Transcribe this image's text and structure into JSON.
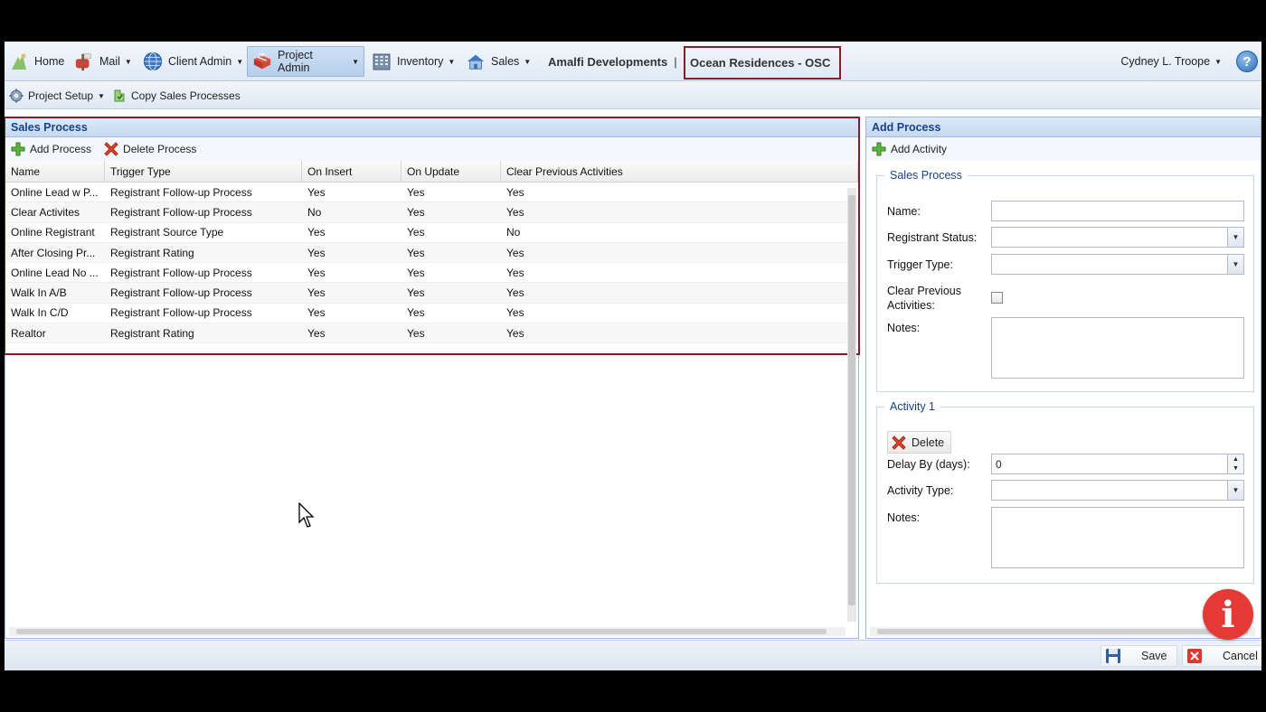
{
  "menubar": {
    "home": "Home",
    "mail": "Mail",
    "client_admin": "Client Admin",
    "project_admin": "Project Admin",
    "inventory": "Inventory",
    "sales": "Sales",
    "company": "Amalfi Developments",
    "project": "Ocean Residences - OSC",
    "user": "Cydney L. Troope",
    "help": "?"
  },
  "subbar": {
    "project_setup": "Project Setup",
    "copy_sales_processes": "Copy Sales Processes"
  },
  "sales_process_panel": {
    "title": "Sales Process",
    "add_process": "Add Process",
    "delete_process": "Delete Process",
    "columns": [
      "Name",
      "Trigger Type",
      "On Insert",
      "On Update",
      "Clear Previous Activities"
    ],
    "rows": [
      [
        "Online Lead w P...",
        "Registrant Follow-up Process",
        "Yes",
        "Yes",
        "Yes"
      ],
      [
        "Clear Activites",
        "Registrant Follow-up Process",
        "No",
        "Yes",
        "Yes"
      ],
      [
        "Online Registrant",
        "Registrant Source Type",
        "Yes",
        "Yes",
        "No"
      ],
      [
        "After Closing Pr...",
        "Registrant Rating",
        "Yes",
        "Yes",
        "Yes"
      ],
      [
        "Online Lead No ...",
        "Registrant Follow-up Process",
        "Yes",
        "Yes",
        "Yes"
      ],
      [
        "Walk In A/B",
        "Registrant Follow-up Process",
        "Yes",
        "Yes",
        "Yes"
      ],
      [
        "Walk In C/D",
        "Registrant Follow-up Process",
        "Yes",
        "Yes",
        "Yes"
      ],
      [
        "Realtor",
        "Registrant Rating",
        "Yes",
        "Yes",
        "Yes"
      ]
    ]
  },
  "add_process_panel": {
    "title": "Add Process",
    "add_activity": "Add Activity",
    "sales_process_legend": "Sales Process",
    "name_label": "Name:",
    "name_value": "",
    "registrant_status_label": "Registrant Status:",
    "registrant_status_value": "",
    "trigger_type_label": "Trigger Type:",
    "trigger_type_value": "",
    "clear_previous_label_1": "Clear Previous",
    "clear_previous_label_2": "Activities:",
    "notes_label": "Notes:",
    "activity_legend": "Activity 1",
    "delete": "Delete",
    "delay_label": "Delay By (days):",
    "delay_value": "0",
    "activity_type_label": "Activity Type:",
    "activity_type_value": "",
    "activity_notes_label": "Notes:"
  },
  "bottombar": {
    "save": "Save",
    "cancel": "Cancel"
  },
  "info_button": "i",
  "colors": {
    "highlight_border": "#8b1a2b",
    "panel_header_text": "#15428b",
    "info_button": "#e53935"
  }
}
